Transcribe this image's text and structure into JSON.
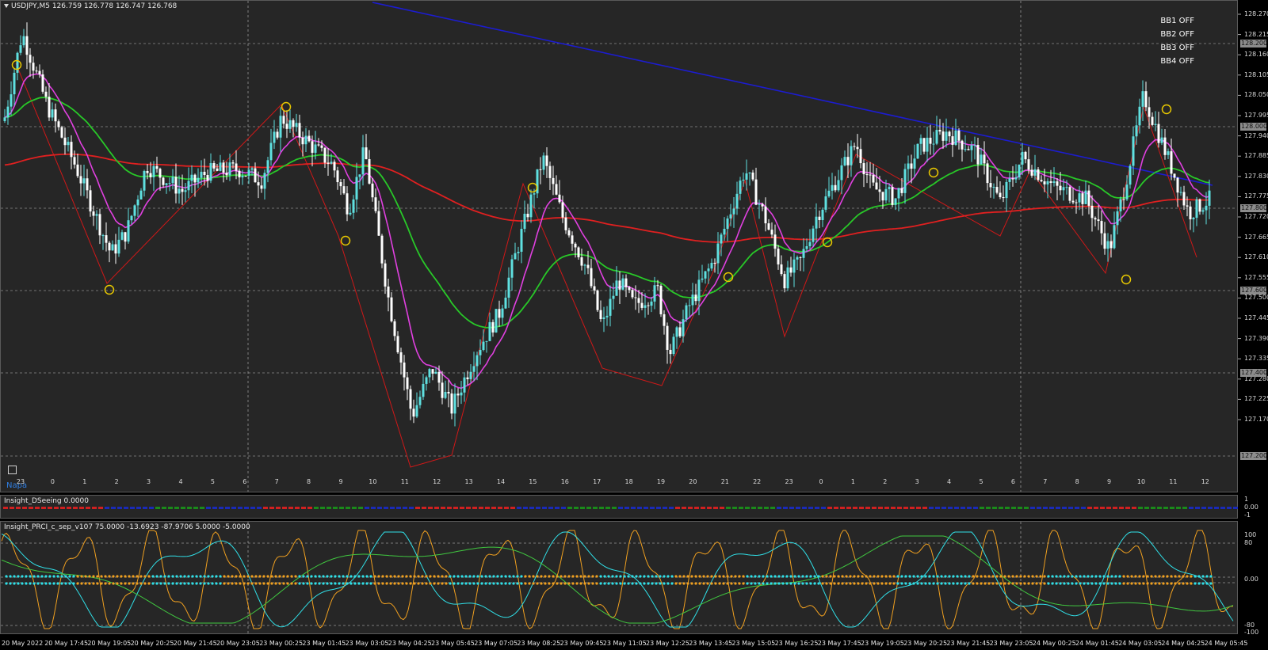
{
  "chart_header": {
    "title": "USDJPY,M5  126.759 126.778 126.747 126.768"
  },
  "bb_toggles": [
    "BB1 OFF",
    "BB2 OFF",
    "BB3 OFF",
    "BB4 OFF"
  ],
  "price_axis": [
    "128.270",
    "128.215",
    "128.160",
    "128.105",
    "128.050",
    "127.995",
    "127.940",
    "127.885",
    "127.830",
    "127.775",
    "127.720",
    "127.665",
    "127.610",
    "127.555",
    "127.500",
    "127.445",
    "127.390",
    "127.335",
    "127.280",
    "127.225",
    "127.170"
  ],
  "price_tags": [
    "128.200",
    "128.000",
    "127.800",
    "127.600",
    "127.400",
    "127.200"
  ],
  "hour_labels": [
    "23",
    "0",
    "1",
    "2",
    "3",
    "4",
    "5",
    "6",
    "7",
    "8",
    "9",
    "10",
    "11",
    "12",
    "13",
    "14",
    "15",
    "16",
    "17",
    "18",
    "19",
    "20",
    "21",
    "22",
    "23",
    "0",
    "1",
    "2",
    "3",
    "4",
    "5",
    "6",
    "7",
    "8",
    "9",
    "10",
    "11",
    "12"
  ],
  "napa_label": "Napa",
  "ds_indicator": {
    "title": "Insight_DSeeing 0.0000",
    "axis": [
      "1",
      "0.00",
      "-1"
    ]
  },
  "prc_indicator": {
    "title": "Insight_PRCI_c_sep_v107 75.0000 -13.6923 -87.9706 5.0000 -5.0000",
    "axis": [
      "100",
      "80",
      "0.00",
      "-80",
      "-100"
    ]
  },
  "time_axis": [
    "20 May 2022",
    "20 May 17:45",
    "20 May 19:05",
    "20 May 20:25",
    "20 May 21:45",
    "20 May 23:05",
    "23 May 00:25",
    "23 May 01:45",
    "23 May 03:05",
    "23 May 04:25",
    "23 May 05:45",
    "23 May 07:05",
    "23 May 08:25",
    "23 May 09:45",
    "23 May 11:05",
    "23 May 12:25",
    "23 May 13:45",
    "23 May 15:05",
    "23 May 16:25",
    "23 May 17:45",
    "23 May 19:05",
    "23 May 20:25",
    "23 May 21:45",
    "23 May 23:05",
    "24 May 00:25",
    "24 May 01:45",
    "24 May 03:05",
    "24 May 04:25",
    "24 May 05:45"
  ],
  "colors": {
    "background": "#262626",
    "bull": "#5fe0e0",
    "bear": "#ffffff",
    "ma_fast": "#e040e0",
    "ma_mid": "#28c828",
    "ma_slow": "#e02020",
    "trendline": "#1c1cd0",
    "zigzag": "#d01818",
    "marker": "#e8c800",
    "prc_orange": "#f0a020",
    "prc_cyan": "#30e0e8",
    "prc_green": "#40c840"
  }
}
